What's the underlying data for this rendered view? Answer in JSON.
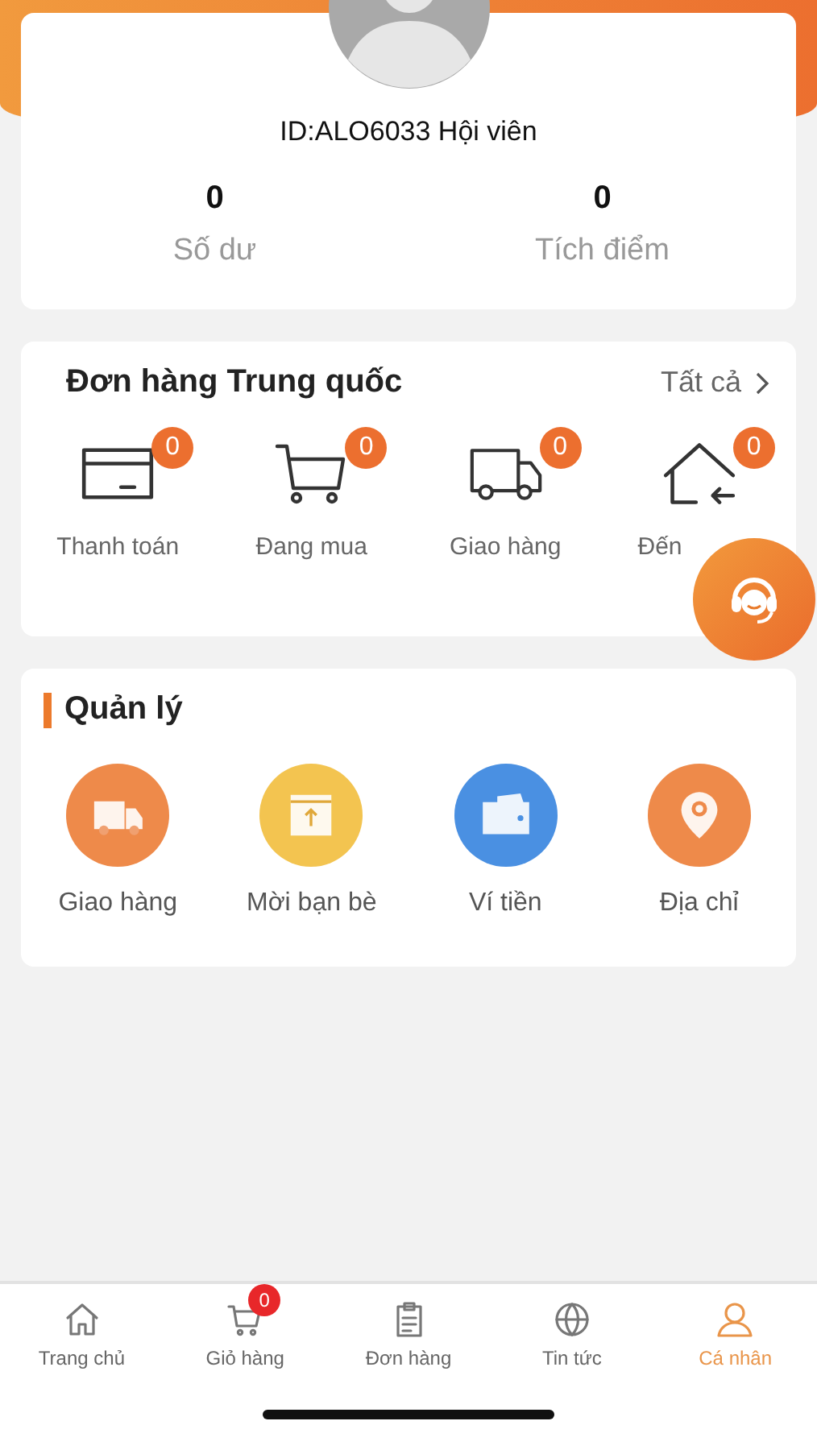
{
  "profile": {
    "member_text": "ID:ALO6033 Hội viên",
    "stats": [
      {
        "value": "0",
        "label": "Số dư"
      },
      {
        "value": "0",
        "label": "Tích điểm"
      }
    ]
  },
  "orders": {
    "title": "Đơn hàng Trung quốc",
    "link": "Tất cả",
    "items": [
      {
        "kind": "card",
        "badge": "0",
        "label": "Thanh toán"
      },
      {
        "kind": "cart",
        "badge": "0",
        "label": "Đang mua"
      },
      {
        "kind": "truck",
        "badge": "0",
        "label": "Giao hàng"
      },
      {
        "kind": "home",
        "badge": "0",
        "label": "Đến"
      }
    ]
  },
  "manage": {
    "title": "Quản lý",
    "items": [
      {
        "kind": "truck",
        "label": "Giao hàng",
        "color": "#ee8a4a"
      },
      {
        "kind": "box",
        "label": "Mời bạn bè",
        "color": "#f3c450"
      },
      {
        "kind": "wallet",
        "label": "Ví tiền",
        "color": "#4a90e2"
      },
      {
        "kind": "pin",
        "label": "Địa chỉ",
        "color": "#ee8a4a"
      }
    ]
  },
  "tabs": [
    {
      "kind": "home",
      "label": "Trang chủ",
      "selected": false
    },
    {
      "kind": "cart",
      "label": "Giỏ hàng",
      "selected": false,
      "badge": "0"
    },
    {
      "kind": "doc",
      "label": "Đơn hàng",
      "selected": false
    },
    {
      "kind": "globe",
      "label": "Tin tức",
      "selected": false
    },
    {
      "kind": "person",
      "label": "Cá nhân",
      "selected": true
    }
  ]
}
